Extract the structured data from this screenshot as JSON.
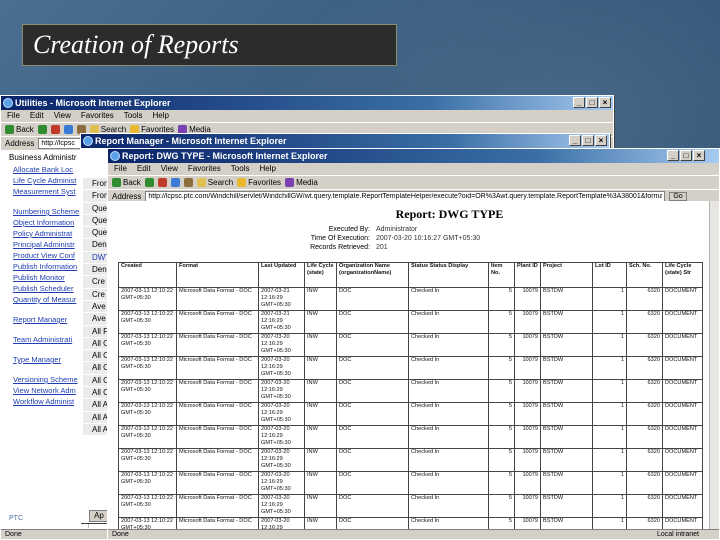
{
  "slide_title": "Creation of Reports",
  "win1": {
    "title": "Utilities - Microsoft Internet Explorer",
    "menu": [
      "File",
      "Edit",
      "View",
      "Favorites",
      "Tools",
      "Help"
    ],
    "toolbar": {
      "back": "Back",
      "search": "Search",
      "favorites": "Favorites",
      "media": "Media"
    },
    "address_label": "Address",
    "address_value": "http://lcpsc",
    "nav_heading": "Business Administr",
    "nav_links_a": [
      "Allocate Bank Loc",
      "Life Cycle Administ",
      "Measurement Syst"
    ],
    "nav_links_b": [
      "Numbering Scheme",
      "Object Information",
      "Policy Administrat",
      "Principal Administr",
      "Product View Conf",
      "Publish Information",
      "Publish Monitor",
      "Publish Scheduler",
      "Quantity of Measur"
    ],
    "nav_links_c": [
      "Report Manager"
    ],
    "nav_links_d": [
      "Team Administrati"
    ],
    "nav_links_e": [
      "Type Manager"
    ],
    "nav_links_f": [
      "Versioning Scheme",
      "View Network Adm",
      "Workflow Administ"
    ],
    "status_text": "Done",
    "logo_text": "PTC"
  },
  "win2": {
    "title": "Report Manager - Microsoft Internet Explorer",
    "items": [
      "From",
      "From",
      "Que",
      "Que",
      "Que",
      "Den",
      "DWT",
      "Den",
      "Cre",
      "Cre",
      "Ave",
      "Ave",
      "All F",
      "All C",
      "All C",
      "All C",
      "All C",
      "All C",
      "All A",
      "All A",
      "All A"
    ],
    "selected_index": 6,
    "task_label": "Ap"
  },
  "win3": {
    "title": "Report: DWG TYPE - Microsoft Internet Explorer",
    "menu": [
      "File",
      "Edit",
      "View",
      "Favorites",
      "Tools",
      "Help"
    ],
    "toolbar": {
      "back": "Back",
      "search": "Search",
      "favorites": "Favorites",
      "media": "Media"
    },
    "address_label": "Address",
    "address_value": "http://lcpsc.ptc.com/Windchill/servlet/WindchillGW/wt.query.template.ReportTemplateHelper/execute?oid=OR%3Awt.query.template.ReportTemplate%3A38001&format=html",
    "go_label": "Go",
    "report_title": "Report: DWG TYPE",
    "meta": [
      {
        "k": "Executed By:",
        "v": "Administrator"
      },
      {
        "k": "Time Of Execution:",
        "v": "2007-03-20 10:16:27 GMT+05:30"
      },
      {
        "k": "Records Retrieved:",
        "v": "201"
      }
    ],
    "table": {
      "headers": [
        "Created",
        "Format",
        "Last Updated",
        "Life Cycle (state)",
        "Organization Name (organizationName)",
        "Status Status Display",
        "Item No.",
        "Plant ID",
        "Project",
        "Lot ID",
        "Sch. No.",
        "Life Cycle (state) Str"
      ],
      "rows": [
        [
          "2007-03-13 12:10:22 GMT+05:30",
          "Microsoft Data Format - DOC",
          "2007-03-21 12:16:29 GMT+05:30",
          "INW",
          "DOC",
          "Checked In",
          "5",
          "10079",
          "BSTDW",
          "1",
          "6320",
          "DOCUMENT"
        ],
        [
          "2007-03-13 12:10:22 GMT+05:30",
          "Microsoft Data Format - DOC",
          "2007-03-21 12:16:29 GMT+05:30",
          "INW",
          "DOC",
          "Checked In",
          "5",
          "10079",
          "BSTDW",
          "1",
          "6320",
          "DOCUMENT"
        ],
        [
          "2007-03-13 12:10:22 GMT+05:30",
          "Microsoft Data Format - DOC",
          "2007-03-20 12:16:29 GMT+05:30",
          "INW",
          "DOC",
          "Checked In",
          "5",
          "10079",
          "BSTDW",
          "1",
          "6320",
          "DOCUMENT"
        ],
        [
          "2007-03-13 12:10:22 GMT+05:30",
          "Microsoft Data Format - DOC",
          "2007-03-20 12:16:29 GMT+05:30",
          "INW",
          "DOC",
          "Checked In",
          "5",
          "10079",
          "BSTDW",
          "1",
          "6320",
          "DOCUMENT"
        ],
        [
          "2007-03-13 12:10:22 GMT+05:30",
          "Microsoft Data Format - DOC",
          "2007-03-20 12:16:29 GMT+05:30",
          "INW",
          "DOC",
          "Checked In",
          "5",
          "10079",
          "BSTDW",
          "1",
          "6320",
          "DOCUMENT"
        ],
        [
          "2007-03-13 12:10:22 GMT+05:30",
          "Microsoft Data Format - DOC",
          "2007-03-20 12:16:29 GMT+05:30",
          "INW",
          "DOC",
          "Checked In",
          "5",
          "10079",
          "BSTDW",
          "1",
          "6320",
          "DOCUMENT"
        ],
        [
          "2007-03-13 12:10:22 GMT+05:30",
          "Microsoft Data Format - DOC",
          "2007-03-20 12:16:29 GMT+05:30",
          "INW",
          "DOC",
          "Checked In",
          "5",
          "10079",
          "BSTDW",
          "1",
          "6320",
          "DOCUMENT"
        ],
        [
          "2007-03-13 12:10:22 GMT+05:30",
          "Microsoft Data Format - DOC",
          "2007-03-20 12:16:29 GMT+05:30",
          "INW",
          "DOC",
          "Checked In",
          "5",
          "10079",
          "BSTDW",
          "1",
          "6320",
          "DOCUMENT"
        ],
        [
          "2007-03-13 12:10:22 GMT+05:30",
          "Microsoft Data Format - DOC",
          "2007-03-20 12:16:29 GMT+05:30",
          "INW",
          "DOC",
          "Checked In",
          "5",
          "10079",
          "BSTDW",
          "1",
          "6320",
          "DOCUMENT"
        ],
        [
          "2007-03-13 12:10:22 GMT+05:30",
          "Microsoft Data Format - DOC",
          "2007-03-20 12:16:29 GMT+05:30",
          "INW",
          "DOC",
          "Checked In",
          "5",
          "10079",
          "BSTDW",
          "1",
          "6320",
          "DOCUMENT"
        ],
        [
          "2007-03-13 12:10:22 GMT+05:30",
          "Microsoft Data Format - DOC",
          "2007-03-20 12:16:29 GMT+05:30",
          "INW",
          "DOC",
          "Checked In",
          "5",
          "10079",
          "BSTDW",
          "1",
          "6320",
          "DOCUMENT"
        ],
        [
          "2007-03-13 12:10:22 GMT+05:30",
          "Microsoft Data Format - DOC",
          "2007-03-20 12:16:29 GMT+05:30",
          "INW",
          "DOC",
          "Checked In",
          "5",
          "10079",
          "BSTDW",
          "1",
          "6320",
          "DOCUMENT"
        ]
      ]
    },
    "status_text": "Done",
    "zone_text": "Local intranet"
  }
}
